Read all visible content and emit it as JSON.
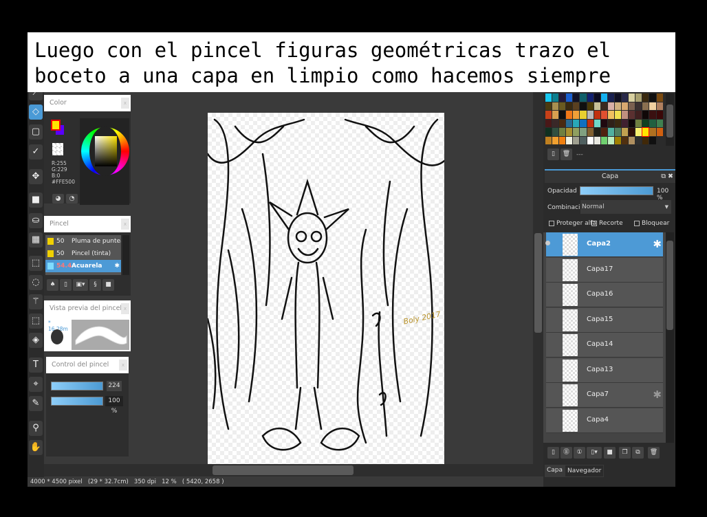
{
  "caption": "Luego con el pincel figuras geométricas trazo el boceto a una capa en limpio como hacemos siempre",
  "tools": [
    "brush-icon",
    "eraser-icon",
    "rectangle-icon",
    "check-icon",
    "move-icon",
    "fill-rect-icon",
    "bucket-icon",
    "gradient-icon",
    "select-rect-icon",
    "lasso-icon",
    "magic-wand-icon",
    "select-pen-icon",
    "select-eraser-icon",
    "text-icon",
    "select-pointer-icon",
    "pen-icon",
    "eyedropper-icon",
    "hand-icon"
  ],
  "color_panel": {
    "title": "Color",
    "r": "R:255",
    "g": "G:229",
    "b": "B:0",
    "hex": "#FFE500",
    "fg": "#ffe500",
    "bg": "#5a00ff"
  },
  "brush_panel": {
    "title": "Pincel",
    "items": [
      {
        "size": "50",
        "name": "Pluma de punteado",
        "color": "#f0d000"
      },
      {
        "size": "50",
        "name": "Pincel (tinta)",
        "color": "#f0d000"
      },
      {
        "size": "54.4",
        "name": "Acuarela",
        "color": "#7fdcff",
        "selected": true
      }
    ]
  },
  "preview_panel": {
    "title": "Vista previa del pincel",
    "size": "* 16.28m"
  },
  "control_panel": {
    "title": "Control del pincel",
    "size_value": "224",
    "opacity_value": "100 %"
  },
  "status": "4000 * 4500 pixel   (29 * 32.7cm)   350 dpi   12 %   ( 5420, 2658 )",
  "palette": [
    "#18c8f0",
    "#0d7f8f",
    "#241a3a",
    "#1a5fcf",
    "#121225",
    "#0f5f6a",
    "#102070",
    "#0b0b20",
    "#14b0f0",
    "#182050",
    "#0f0f22",
    "#2a2a4a",
    "#d8d0a0",
    "#a8a070",
    "#3a2a10",
    "#101010",
    "#7a4a10",
    "#4a3a10",
    "#a89050",
    "#6a5a20",
    "#3a2a10",
    "#5a4020",
    "#101010",
    "#4a3a08",
    "#c8c098",
    "#3a2a20",
    "#d8b0a8",
    "#d0b080",
    "#d8a870",
    "#7a6050",
    "#3a3030",
    "#8a7050",
    "#f0d0a0",
    "#b08060",
    "#c84018",
    "#d8a050",
    "#101010",
    "#f07818",
    "#f0a038",
    "#e8d030",
    "#b8b8b8",
    "#c03010",
    "#e05030",
    "#f0c060",
    "#f0e050",
    "#c09080",
    "#5a3030",
    "#402020",
    "#100808",
    "#3a1010",
    "#3a0808",
    "#4a1818",
    "#3a2828",
    "#4a2a10",
    "#2a6a90",
    "#28a8b8",
    "#1070c0",
    "#c03010",
    "#70d8c8",
    "#200810",
    "#302018",
    "#3a2810",
    "#402030",
    "#100808",
    "#708040",
    "#104020",
    "#206040",
    "#408050",
    "#103020",
    "#305040",
    "#708040",
    "#a89030",
    "#90a060",
    "#80a080",
    "#806030",
    "#202018",
    "#502010",
    "#50b0a0",
    "#508060",
    "#c0a050",
    "#301008",
    "#f8f070",
    "#ffe500",
    "#b07020",
    "#d06010",
    "#c08020",
    "#f0a030",
    "#f08010",
    "#f0f0e0",
    "#a0a090",
    "#506060",
    "#ffffff",
    "#e8e8e0",
    "#70d070",
    "#c0f0c0",
    "#a08000",
    "#503010",
    "#b09060",
    "#303030",
    "#402808",
    "#101010"
  ],
  "palette_footer": "---",
  "layer_panel": {
    "title": "Capa",
    "opacity_label": "Opacidad",
    "opacity_value": "100 %",
    "opacity": 100,
    "blend_label": "Combinación",
    "blend_value": "Normal",
    "protect_alpha": "Proteger alfa",
    "clipping": "Recorte",
    "lock": "Bloquear",
    "layers": [
      {
        "name": "Capa2",
        "selected": true,
        "visible": true
      },
      {
        "name": "Capa17"
      },
      {
        "name": "Capa16"
      },
      {
        "name": "Capa15"
      },
      {
        "name": "Capa14"
      },
      {
        "name": "Capa13"
      },
      {
        "name": "Capa7",
        "settings": true
      },
      {
        "name": "Capa4"
      }
    ]
  },
  "bottom_tabs": [
    "Capa",
    "Navegador"
  ],
  "signature": "Boly 2017"
}
